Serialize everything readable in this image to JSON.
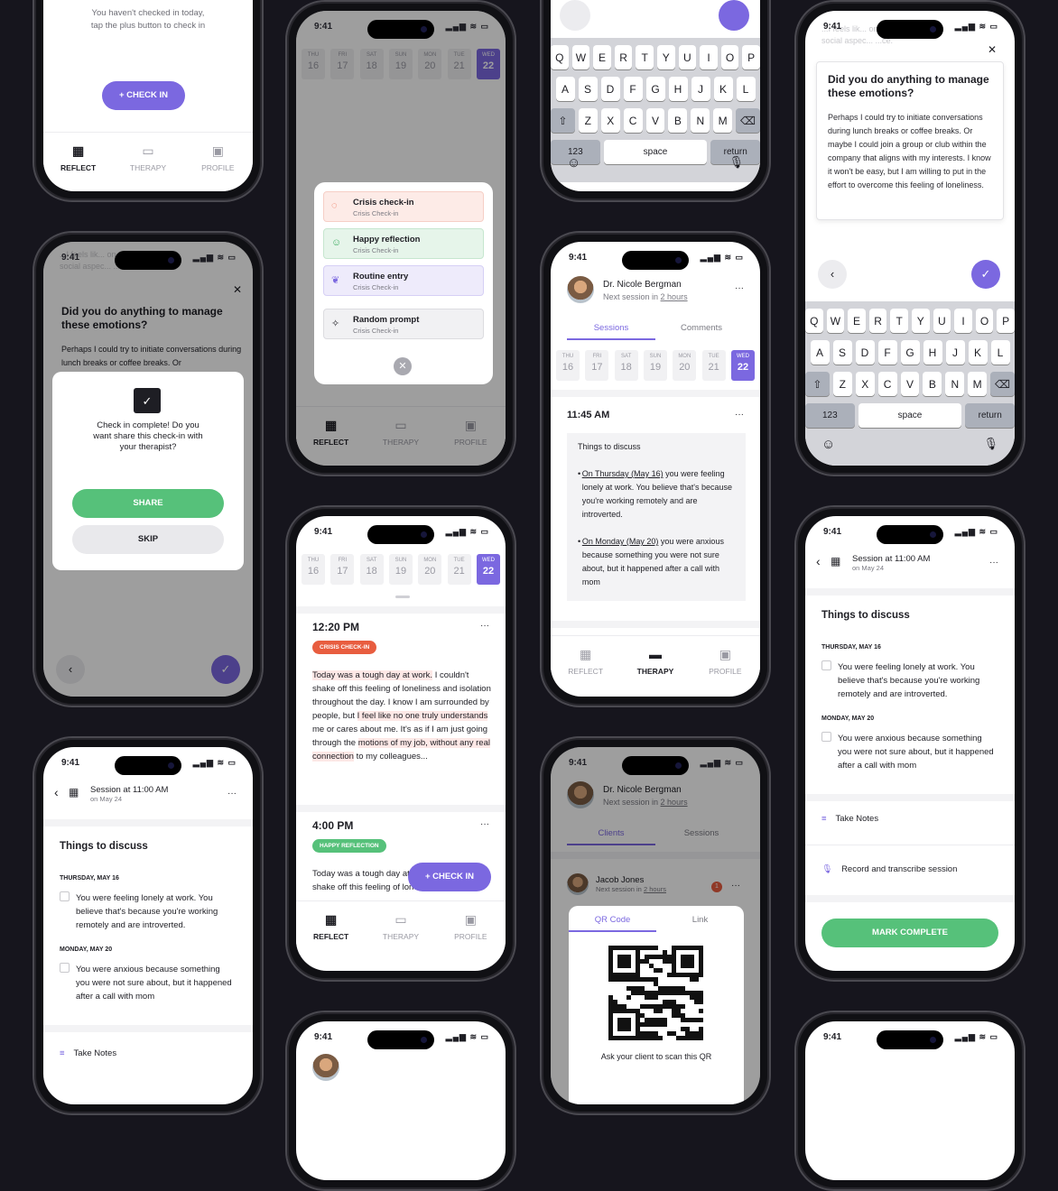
{
  "status_time": "9:41",
  "status_icons": "▂▄▆ ≋ ▭",
  "nav": {
    "reflect": "REFLECT",
    "therapy": "THERAPY",
    "profile": "PROFILE"
  },
  "week": [
    {
      "d": "THU",
      "n": "16"
    },
    {
      "d": "FRI",
      "n": "17"
    },
    {
      "d": "SAT",
      "n": "18"
    },
    {
      "d": "SUN",
      "n": "19"
    },
    {
      "d": "MON",
      "n": "20"
    },
    {
      "d": "TUE",
      "n": "21"
    },
    {
      "d": "WED",
      "n": "22"
    }
  ],
  "empty": {
    "line1": "You haven't checked in today,",
    "line2": "tap the plus button to check in",
    "checkin": "CHECK IN"
  },
  "menu": {
    "items": [
      {
        "title": "Crisis check-in",
        "sub": "Crisis Check-in"
      },
      {
        "title": "Happy reflection",
        "sub": "Crisis Check-in"
      },
      {
        "title": "Routine entry",
        "sub": "Crisis Check-in"
      },
      {
        "title": "Random prompt",
        "sub": "Crisis Check-in"
      }
    ]
  },
  "keyboard": {
    "row1": [
      "Q",
      "W",
      "E",
      "R",
      "T",
      "Y",
      "U",
      "I",
      "O",
      "P"
    ],
    "row2": [
      "A",
      "S",
      "D",
      "F",
      "G",
      "H",
      "J",
      "K",
      "L"
    ],
    "row3": [
      "Z",
      "X",
      "C",
      "V",
      "B",
      "N",
      "M"
    ],
    "num": "123",
    "space": "space",
    "ret": "return"
  },
  "prompt": {
    "ghost1": "...I feels lik... on the",
    "ghost2": "social aspec... ...ce.",
    "question": "Did you do anything to manage these emotions?",
    "answer": "Perhaps I could try to initiate conversations during lunch breaks or coffee breaks. Or maybe I could join a group or club within the company that aligns with my interests. I know it won't be easy, but I am willing to put in the effort to overcome this feeling of loneliness.",
    "answer_short": "Perhaps I could try to initiate conversations during lunch breaks or coffee breaks. Or"
  },
  "complete": {
    "text": "Check in complete! Do you want share this check-in with your therapist?",
    "share": "SHARE",
    "skip": "SKIP"
  },
  "entries": {
    "e1": {
      "time": "12:20 PM",
      "tag": "CRISIS CHECK-IN",
      "text": "Today was a tough day at work. I couldn't shake off this feeling of loneliness and isolation throughout the day. I know I am surrounded by people, but I feel like no one truly understands me or cares about me. It's as if I am just going through the motions of my job, without any real connection to my colleagues..."
    },
    "e2": {
      "time": "4:00 PM",
      "tag": "HAPPY REFLECTION",
      "text": "Today was a tough day at work. I couldn't shake off this feeling of loneliness and"
    }
  },
  "therapist": {
    "name": "Dr. Nicole Bergman",
    "next": "Next session in",
    "hours": "2 hours",
    "tab_sessions": "Sessions",
    "tab_comments": "Comments",
    "tab_clients": "Clients",
    "time": "11:45 AM",
    "things": "Things to discuss",
    "b1a": "On Thursday (May 16)",
    "b1b": "you were feeling lonely at work. You believe that's because you're working remotely and are introverted.",
    "b2a": "On Monday (May 20)",
    "b2b": "you were anxious because something you were not sure about, but it happened after a call with mom"
  },
  "session": {
    "title": "Session at 11:00 AM",
    "sub": "on May 24",
    "things": "Things to discuss",
    "d1": "THURSDAY, MAY 16",
    "t1": "You were feeling lonely at work. You believe that's because you're working remotely and are introverted.",
    "d2": "MONDAY, MAY 20",
    "t2": "You were anxious because something you were not sure about, but it happened after a call with mom",
    "notes": "Take Notes",
    "record": "Record and transcribe session",
    "mark": "MARK COMPLETE"
  },
  "client": {
    "name": "Jacob Jones",
    "next": "Next session in",
    "hours": "2 hours",
    "badge": "1"
  },
  "qr": {
    "tab_qr": "QR Code",
    "tab_link": "Link",
    "caption": "Ask your client to scan this QR"
  },
  "colors": {
    "purple": "#7b68e0",
    "green": "#56c17a",
    "red": "#e85d3f"
  }
}
